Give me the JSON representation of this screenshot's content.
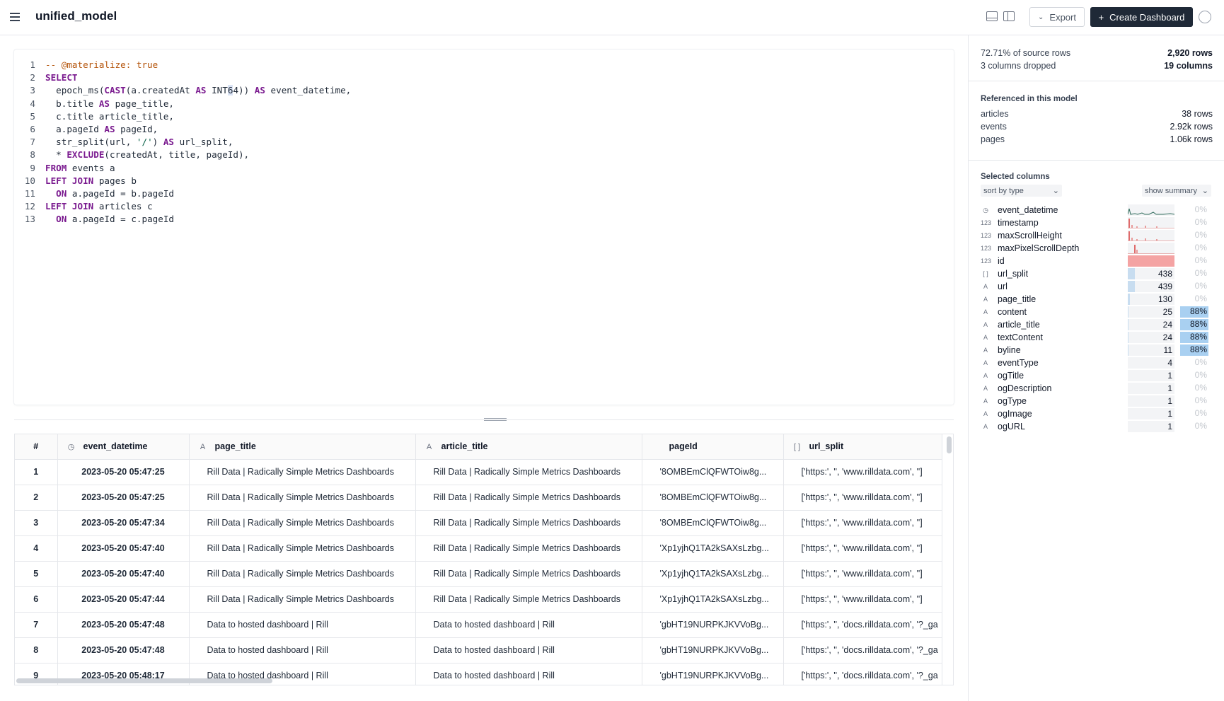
{
  "header": {
    "title": "unified_model",
    "export_label": "Export",
    "create_label": "Create Dashboard"
  },
  "editor": {
    "lines": [
      {
        "n": "1",
        "html": "<span class=\"cm\">-- @materialize: true</span>"
      },
      {
        "n": "2",
        "html": "<span class=\"kw\">SELECT</span>"
      },
      {
        "n": "3",
        "html": "  epoch_ms(<span class=\"kw\">CAST</span>(a.createdAt <span class=\"kw\">AS</span> INT<span class=\"cursor-mark\">6</span>4)) <span class=\"kw\">AS</span> event_datetime,"
      },
      {
        "n": "4",
        "html": "  b.title <span class=\"kw\">AS</span> page_title,"
      },
      {
        "n": "5",
        "html": "  c.title article_title,"
      },
      {
        "n": "6",
        "html": "  a.pageId <span class=\"kw\">AS</span> pageId,"
      },
      {
        "n": "7",
        "html": "  str_split(url, <span class=\"str\">'/'</span>) <span class=\"kw\">AS</span> url_split,"
      },
      {
        "n": "8",
        "html": "  * <span class=\"kw\">EXCLUDE</span>(createdAt, title, pageId),"
      },
      {
        "n": "9",
        "html": "<span class=\"kw\">FROM</span> events a"
      },
      {
        "n": "10",
        "html": "<span class=\"kw\">LEFT JOIN</span> pages b"
      },
      {
        "n": "11",
        "html": "  <span class=\"kw\">ON</span> a.pageId = b.pageId"
      },
      {
        "n": "12",
        "html": "<span class=\"kw\">LEFT JOIN</span> articles c"
      },
      {
        "n": "13",
        "html": "  <span class=\"kw\">ON</span> a.pageId = c.pageId"
      }
    ]
  },
  "table": {
    "columns": [
      {
        "label": "#",
        "icon": ""
      },
      {
        "label": "event_datetime",
        "icon": "◷"
      },
      {
        "label": "page_title",
        "icon": "A"
      },
      {
        "label": "article_title",
        "icon": "A"
      },
      {
        "label": "pageId",
        "icon": ""
      },
      {
        "label": "url_split",
        "icon": "[ ]"
      }
    ],
    "rows": [
      [
        "1",
        "2023-05-20 05:47:25",
        "Rill Data | Radically Simple Metrics Dashboards",
        "Rill Data | Radically Simple Metrics Dashboards",
        "'8OMBEmClQFWTOiw8g...",
        "['https:', '', 'www.rilldata.com', '']"
      ],
      [
        "2",
        "2023-05-20 05:47:25",
        "Rill Data | Radically Simple Metrics Dashboards",
        "Rill Data | Radically Simple Metrics Dashboards",
        "'8OMBEmClQFWTOiw8g...",
        "['https:', '', 'www.rilldata.com', '']"
      ],
      [
        "3",
        "2023-05-20 05:47:34",
        "Rill Data | Radically Simple Metrics Dashboards",
        "Rill Data | Radically Simple Metrics Dashboards",
        "'8OMBEmClQFWTOiw8g...",
        "['https:', '', 'www.rilldata.com', '']"
      ],
      [
        "4",
        "2023-05-20 05:47:40",
        "Rill Data | Radically Simple Metrics Dashboards",
        "Rill Data | Radically Simple Metrics Dashboards",
        "'Xp1yjhQ1TA2kSAXsLzbg...",
        "['https:', '', 'www.rilldata.com', '']"
      ],
      [
        "5",
        "2023-05-20 05:47:40",
        "Rill Data | Radically Simple Metrics Dashboards",
        "Rill Data | Radically Simple Metrics Dashboards",
        "'Xp1yjhQ1TA2kSAXsLzbg...",
        "['https:', '', 'www.rilldata.com', '']"
      ],
      [
        "6",
        "2023-05-20 05:47:44",
        "Rill Data | Radically Simple Metrics Dashboards",
        "Rill Data | Radically Simple Metrics Dashboards",
        "'Xp1yjhQ1TA2kSAXsLzbg...",
        "['https:', '', 'www.rilldata.com', '']"
      ],
      [
        "7",
        "2023-05-20 05:47:48",
        "Data to hosted dashboard | Rill",
        "Data to hosted dashboard | Rill",
        "'gbHT19NURPKJKVVoBg...",
        "['https:', '', 'docs.rilldata.com', '?_ga"
      ],
      [
        "8",
        "2023-05-20 05:47:48",
        "Data to hosted dashboard | Rill",
        "Data to hosted dashboard | Rill",
        "'gbHT19NURPKJKVVoBg...",
        "['https:', '', 'docs.rilldata.com', '?_ga"
      ],
      [
        "9",
        "2023-05-20 05:48:17",
        "Data to hosted dashboard | Rill",
        "Data to hosted dashboard | Rill",
        "'gbHT19NURPKJKVVoBg...",
        "['https:', '', 'docs.rilldata.com', '?_ga"
      ]
    ]
  },
  "inspector": {
    "source_pct": "72.71% of source rows",
    "row_count": "2,920 rows",
    "cols_dropped": "3 columns dropped",
    "col_count": "19 columns",
    "referenced_heading": "Referenced in this model",
    "references": [
      {
        "name": "articles",
        "rows": "38 rows"
      },
      {
        "name": "events",
        "rows": "2.92k rows"
      },
      {
        "name": "pages",
        "rows": "1.06k rows"
      }
    ],
    "selected_heading": "Selected columns",
    "sort_label": "sort by type",
    "summary_label": "show summary",
    "columns": [
      {
        "icon": "◷",
        "name": "event_datetime",
        "kind": "hist-time",
        "card": "",
        "card_frac": 0,
        "null": "0%",
        "null_hi": false
      },
      {
        "icon": "123",
        "name": "timestamp",
        "kind": "hist",
        "card": "",
        "card_frac": 0,
        "null": "0%",
        "null_hi": false
      },
      {
        "icon": "123",
        "name": "maxScrollHeight",
        "kind": "hist",
        "card": "",
        "card_frac": 0,
        "null": "0%",
        "null_hi": false
      },
      {
        "icon": "123",
        "name": "maxPixelScrollDepth",
        "kind": "hist2",
        "card": "",
        "card_frac": 0,
        "null": "0%",
        "null_hi": false
      },
      {
        "icon": "123",
        "name": "id",
        "kind": "full-red",
        "card": "",
        "card_frac": 1,
        "null": "0%",
        "null_hi": false
      },
      {
        "icon": "[ ]",
        "name": "url_split",
        "kind": "bar",
        "card": "438",
        "card_frac": 0.15,
        "null": "0%",
        "null_hi": false
      },
      {
        "icon": "A",
        "name": "url",
        "kind": "bar",
        "card": "439",
        "card_frac": 0.15,
        "null": "0%",
        "null_hi": false
      },
      {
        "icon": "A",
        "name": "page_title",
        "kind": "bar",
        "card": "130",
        "card_frac": 0.045,
        "null": "0%",
        "null_hi": false
      },
      {
        "icon": "A",
        "name": "content",
        "kind": "bar",
        "card": "25",
        "card_frac": 0.01,
        "null": "88%",
        "null_hi": true
      },
      {
        "icon": "A",
        "name": "article_title",
        "kind": "bar",
        "card": "24",
        "card_frac": 0.01,
        "null": "88%",
        "null_hi": true
      },
      {
        "icon": "A",
        "name": "textContent",
        "kind": "bar",
        "card": "24",
        "card_frac": 0.01,
        "null": "88%",
        "null_hi": true
      },
      {
        "icon": "A",
        "name": "byline",
        "kind": "bar",
        "card": "11",
        "card_frac": 0.005,
        "null": "88%",
        "null_hi": true
      },
      {
        "icon": "A",
        "name": "eventType",
        "kind": "bar",
        "card": "4",
        "card_frac": 0,
        "null": "0%",
        "null_hi": false
      },
      {
        "icon": "A",
        "name": "ogTitle",
        "kind": "bar",
        "card": "1",
        "card_frac": 0,
        "null": "0%",
        "null_hi": false
      },
      {
        "icon": "A",
        "name": "ogDescription",
        "kind": "bar",
        "card": "1",
        "card_frac": 0,
        "null": "0%",
        "null_hi": false
      },
      {
        "icon": "A",
        "name": "ogType",
        "kind": "bar",
        "card": "1",
        "card_frac": 0,
        "null": "0%",
        "null_hi": false
      },
      {
        "icon": "A",
        "name": "ogImage",
        "kind": "bar",
        "card": "1",
        "card_frac": 0,
        "null": "0%",
        "null_hi": false
      },
      {
        "icon": "A",
        "name": "ogURL",
        "kind": "bar",
        "card": "1",
        "card_frac": 0,
        "null": "0%",
        "null_hi": false
      }
    ]
  }
}
